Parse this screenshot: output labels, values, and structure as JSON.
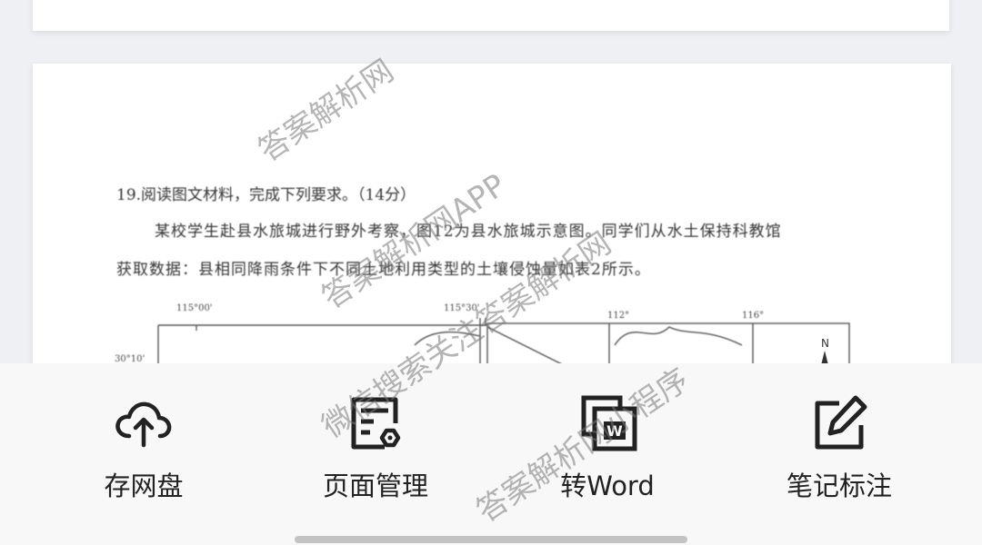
{
  "document": {
    "question_title": "19.阅读图文材料，完成下列要求。（14分）",
    "question_line1": "某校学生赴县水旅城进行野外考察，图12为县水旅城示意图。同学们从水土保持科教馆",
    "question_line2": "获取数据：县相同降雨条件下不同土地利用类型的土壤侵蚀量如表2所示。",
    "map_coords": [
      "115°00'",
      "115°30'",
      "112°",
      "116°",
      "30°10'"
    ],
    "north_label": "N"
  },
  "watermarks": [
    "答案解析网",
    "答案解析网APP",
    "微信搜索关注答案解析网",
    "答案解析网小程序"
  ],
  "actions": [
    {
      "label": "存网盘",
      "icon": "cloud-upload-icon"
    },
    {
      "label": "页面管理",
      "icon": "page-settings-icon"
    },
    {
      "label": "转Word",
      "icon": "word-convert-icon"
    },
    {
      "label": "笔记标注",
      "icon": "edit-note-icon"
    }
  ],
  "colors": {
    "icon": "#222222",
    "panel": "#f8f8f8",
    "background": "#eef0f3"
  }
}
